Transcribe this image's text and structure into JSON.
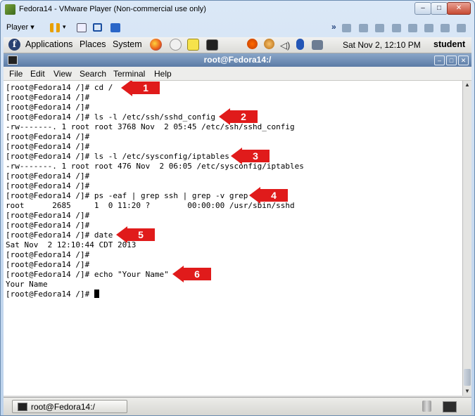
{
  "vmware": {
    "title": "Fedora14 - VMware Player (Non-commercial use only)",
    "player_menu": "Player ▾",
    "more": "»"
  },
  "gnome_panel": {
    "menus": [
      "Applications",
      "Places",
      "System"
    ],
    "clock": "Sat Nov  2, 12:10 PM",
    "user": "student"
  },
  "terminal": {
    "title": "root@Fedora14:/",
    "menus": [
      "File",
      "Edit",
      "View",
      "Search",
      "Terminal",
      "Help"
    ],
    "lines": [
      "[root@Fedora14 /]# cd /",
      "[root@Fedora14 /]#",
      "[root@Fedora14 /]#",
      "[root@Fedora14 /]# ls -l /etc/ssh/sshd_config",
      "-rw-------. 1 root root 3768 Nov  2 05:45 /etc/ssh/sshd_config",
      "[root@Fedora14 /]#",
      "[root@Fedora14 /]#",
      "[root@Fedora14 /]# ls -l /etc/sysconfig/iptables",
      "-rw-------. 1 root root 476 Nov  2 06:05 /etc/sysconfig/iptables",
      "[root@Fedora14 /]#",
      "[root@Fedora14 /]#",
      "[root@Fedora14 /]# ps -eaf | grep ssh | grep -v grep",
      "root      2685     1  0 11:20 ?        00:00:00 /usr/sbin/sshd",
      "[root@Fedora14 /]#",
      "[root@Fedora14 /]#",
      "[root@Fedora14 /]# date",
      "Sat Nov  2 12:10:44 CDT 2013",
      "[root@Fedora14 /]#",
      "[root@Fedora14 /]#",
      "[root@Fedora14 /]# echo \"Your Name\"",
      "Your Name",
      "[root@Fedora14 /]# "
    ]
  },
  "annotations": [
    "1",
    "2",
    "3",
    "4",
    "5",
    "6"
  ],
  "taskbar": {
    "task_label": "root@Fedora14:/"
  },
  "colors": {
    "annotation_red": "#e01b1b",
    "term_titlebar": "#5b7ba6"
  }
}
